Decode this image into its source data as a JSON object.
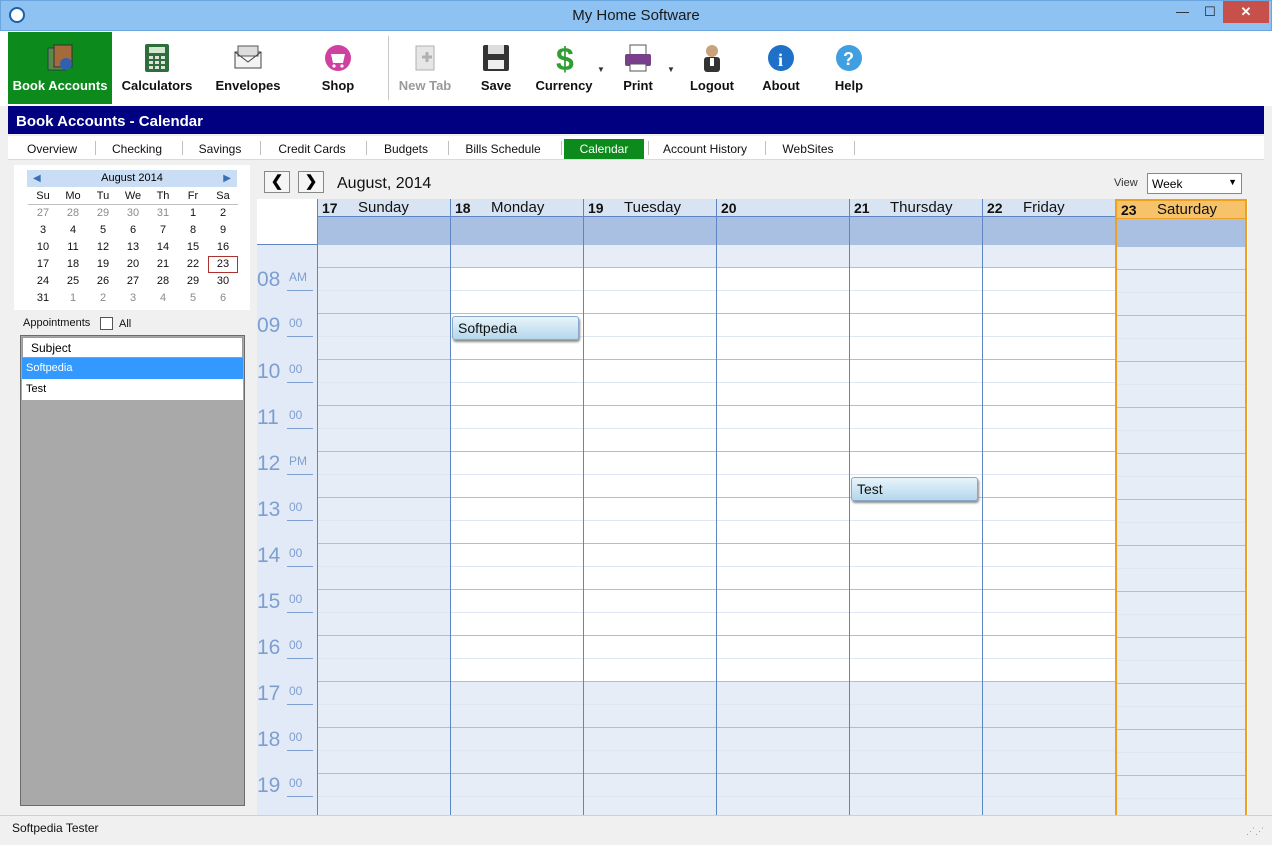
{
  "window": {
    "title": "My Home Software",
    "min": "—",
    "max": "☐",
    "close": "✕"
  },
  "toolbar": [
    {
      "label": "Book Accounts",
      "icon": "book-accounts-icon"
    },
    {
      "label": "Calculators",
      "icon": "calculator-icon"
    },
    {
      "label": "Envelopes",
      "icon": "envelopes-icon"
    },
    {
      "label": "Shop",
      "icon": "shop-icon"
    },
    {
      "label": "New Tab",
      "icon": "new-tab-icon"
    },
    {
      "label": "Save",
      "icon": "save-icon"
    },
    {
      "label": "Currency",
      "icon": "currency-icon"
    },
    {
      "label": "Print",
      "icon": "print-icon"
    },
    {
      "label": "Logout",
      "icon": "logout-icon"
    },
    {
      "label": "About",
      "icon": "about-icon"
    },
    {
      "label": "Help",
      "icon": "help-icon"
    }
  ],
  "header": {
    "title": "Book Accounts - Calendar"
  },
  "tabs": [
    "Overview",
    "Checking",
    "Savings",
    "Credit Cards",
    "Budgets",
    "Bills Schedule",
    "Calendar",
    "Account History",
    "WebSites"
  ],
  "mini_calendar": {
    "month": "August 2014",
    "dow": [
      "Su",
      "Mo",
      "Tu",
      "We",
      "Th",
      "Fr",
      "Sa"
    ],
    "weeks": [
      [
        "27",
        "28",
        "29",
        "30",
        "31",
        "1",
        "2"
      ],
      [
        "3",
        "4",
        "5",
        "6",
        "7",
        "8",
        "9"
      ],
      [
        "10",
        "11",
        "12",
        "13",
        "14",
        "15",
        "16"
      ],
      [
        "17",
        "18",
        "19",
        "20",
        "21",
        "22",
        "23"
      ],
      [
        "24",
        "25",
        "26",
        "27",
        "28",
        "29",
        "30"
      ],
      [
        "31",
        "1",
        "2",
        "3",
        "4",
        "5",
        "6"
      ]
    ]
  },
  "appointments": {
    "label": "Appointments",
    "all_label": "All",
    "column": "Subject",
    "rows": [
      "Softpedia",
      "Test"
    ]
  },
  "calendar": {
    "month_title": "August, 2014",
    "view_label": "View",
    "view_value": "Week",
    "prev": "❮",
    "next": "❯",
    "days": [
      {
        "num": "17",
        "name": "Sunday"
      },
      {
        "num": "18",
        "name": "Monday"
      },
      {
        "num": "19",
        "name": "Tuesday"
      },
      {
        "num": "20",
        "name": ""
      },
      {
        "num": "21",
        "name": "Thursday"
      },
      {
        "num": "22",
        "name": "Friday"
      },
      {
        "num": "23",
        "name": "Saturday"
      }
    ],
    "hours": [
      {
        "h": "08",
        "m": "AM"
      },
      {
        "h": "09",
        "m": "00"
      },
      {
        "h": "10",
        "m": "00"
      },
      {
        "h": "11",
        "m": "00"
      },
      {
        "h": "12",
        "m": "PM"
      },
      {
        "h": "13",
        "m": "00"
      },
      {
        "h": "14",
        "m": "00"
      },
      {
        "h": "15",
        "m": "00"
      },
      {
        "h": "16",
        "m": "00"
      },
      {
        "h": "17",
        "m": "00"
      },
      {
        "h": "18",
        "m": "00"
      },
      {
        "h": "19",
        "m": "00"
      }
    ],
    "events": [
      {
        "title": "Softpedia",
        "day": "18",
        "time": "09:00"
      },
      {
        "title": "Test",
        "day": "21",
        "time": "12:30"
      }
    ]
  },
  "status": {
    "user": "Softpedia Tester"
  },
  "colors": {
    "accent_green": "#0d8a1c",
    "header_navy": "#000080",
    "today_orange": "#f0a020"
  }
}
